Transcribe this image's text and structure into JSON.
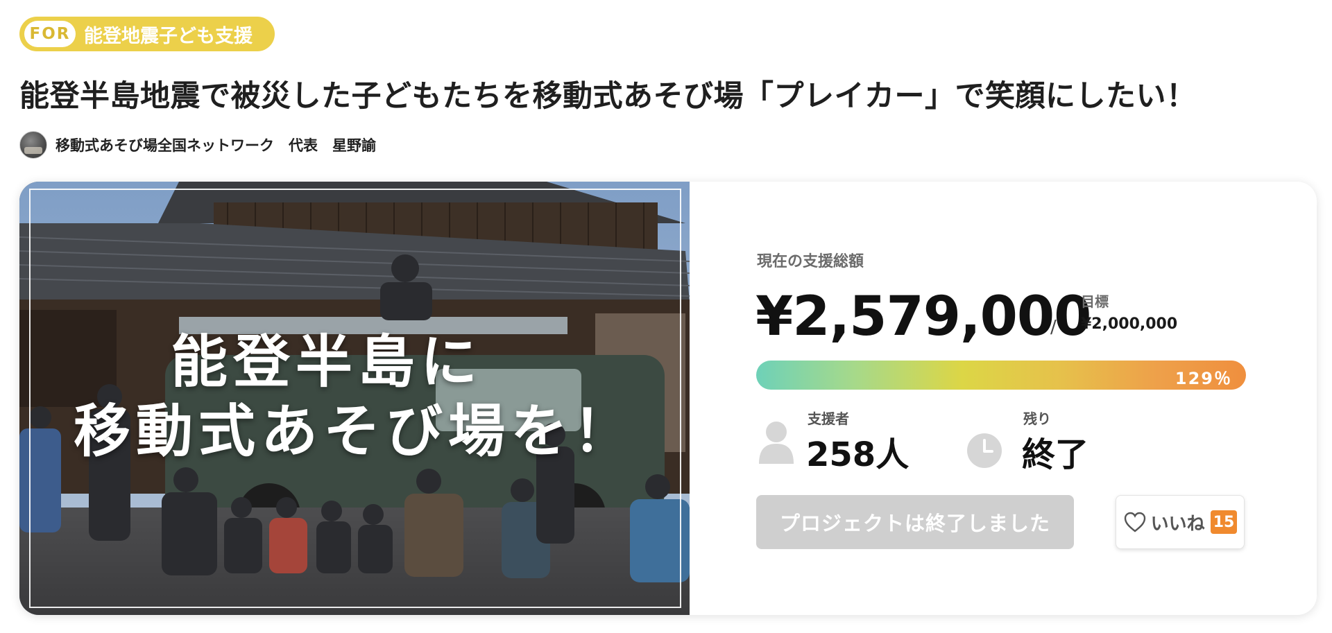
{
  "category_badge": {
    "prefix": "FOR",
    "label": "能登地震子ども支援"
  },
  "project": {
    "title": "能登半島地震で被災した子どもたちを移動式あそび場「プレイカー」で笑顔にしたい！",
    "owner": "移動式あそび場全国ネットワーク　代表　星野諭"
  },
  "hero": {
    "caption_line1": "能登半島に",
    "caption_line2": "移動式あそび場を！"
  },
  "stats": {
    "total_label": "現在の支援総額",
    "total_amount": "¥2,579,000",
    "goal_separator": "/",
    "goal_label": "目標",
    "goal_amount": "¥2,000,000",
    "progress_text": "129％",
    "progress_fraction": 1.0,
    "backers_label": "支援者",
    "backers_value": "258人",
    "remaining_label": "残り",
    "remaining_value": "終了"
  },
  "actions": {
    "ended_button_label": "プロジェクトは終了しました",
    "like_label": "いいね",
    "like_count": "15"
  },
  "icons": {
    "backers": "person-icon",
    "remaining": "clock-icon",
    "like": "heart-icon"
  },
  "colors": {
    "badge": "#ecd04a",
    "like_count_badge": "#f08a2e",
    "ended_button": "#cfcfcf"
  }
}
